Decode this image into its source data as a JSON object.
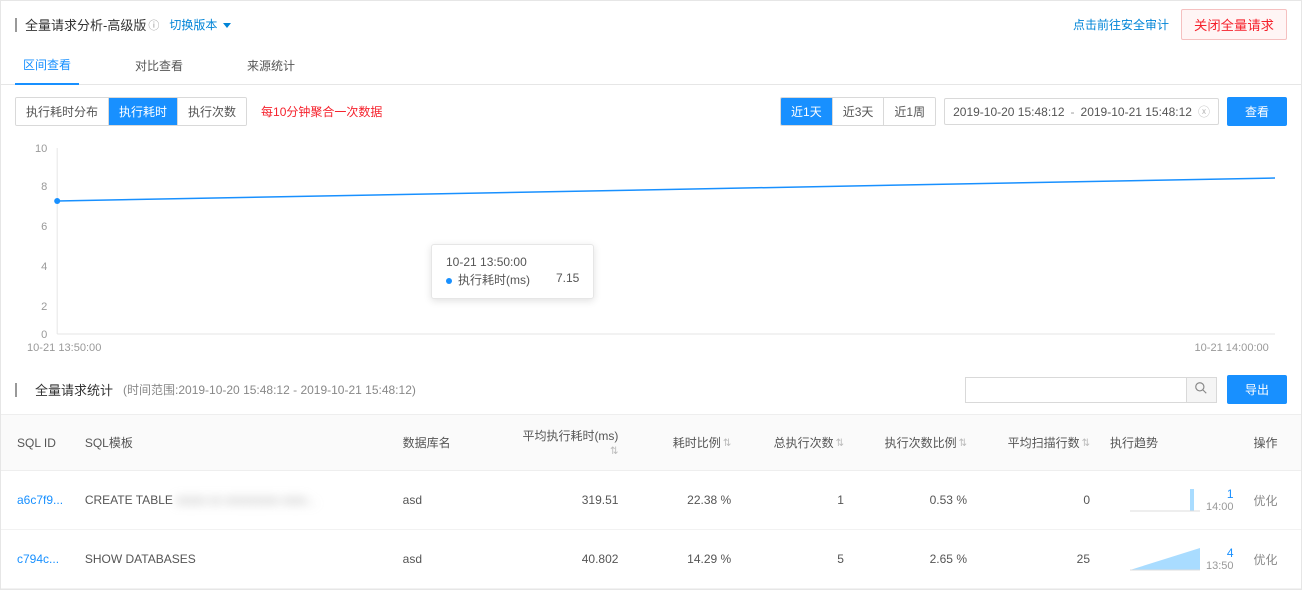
{
  "header": {
    "title": "全量请求分析-高级版",
    "help_icon": "help-icon",
    "switch_version": "切换版本",
    "audit_link": "点击前往安全审计",
    "close_btn": "关闭全量请求"
  },
  "tabs": [
    {
      "id": "interval",
      "label": "区间查看",
      "active": true
    },
    {
      "id": "compare",
      "label": "对比查看",
      "active": false
    },
    {
      "id": "source",
      "label": "来源统计",
      "active": false
    }
  ],
  "filter_group": [
    {
      "id": "dist",
      "label": "执行耗时分布",
      "active": false
    },
    {
      "id": "time",
      "label": "执行耗时",
      "active": true
    },
    {
      "id": "count",
      "label": "执行次数",
      "active": false
    }
  ],
  "agg_hint": "每10分钟聚合一次数据",
  "range_group": [
    {
      "id": "1d",
      "label": "近1天",
      "active": true
    },
    {
      "id": "3d",
      "label": "近3天",
      "active": false
    },
    {
      "id": "1w",
      "label": "近1周",
      "active": false
    }
  ],
  "time_range": {
    "from": "2019-10-20 15:48:12",
    "sep": "-",
    "to": "2019-10-21 15:48:12"
  },
  "view_btn": "查看",
  "chart_data": {
    "type": "line",
    "x": [
      "10-21 13:50:00",
      "10-21 14:00:00"
    ],
    "values": [
      7.15,
      8.4
    ],
    "ylim": [
      0,
      10
    ],
    "yticks": [
      0,
      2,
      4,
      6,
      8,
      10
    ],
    "xlabel": "",
    "ylabel": "",
    "series_name": "执行耗时(ms)",
    "tooltip": {
      "x": "10-21 13:50:00",
      "label": "执行耗时(ms)",
      "value": "7.15"
    },
    "accent": "#1890ff"
  },
  "section": {
    "title": "全量请求统计",
    "subtitle": "(时间范围:2019-10-20 15:48:12 - 2019-10-21 15:48:12)",
    "search_placeholder": "",
    "export_btn": "导出"
  },
  "table": {
    "columns": {
      "sql_id": "SQL ID",
      "template": "SQL模板",
      "db": "数据库名",
      "avg_time": "平均执行耗时(ms)",
      "time_pct": "耗时比例",
      "exec_count": "总执行次数",
      "exec_pct": "执行次数比例",
      "scan_rows": "平均扫描行数",
      "trend": "执行趋势",
      "ops": "操作"
    },
    "rows": [
      {
        "sql_id": "a6c7f9...",
        "template_prefix": "CREATE TABLE ",
        "template_blur": "xxxxx xx xxxxxxxxx xxxx...",
        "db": "asd",
        "avg_time": "319.51",
        "time_pct": "22.38 %",
        "exec_count": "1",
        "exec_pct": "0.53 %",
        "scan_rows": "0",
        "trend": {
          "shape": "spike",
          "value": "1",
          "time": "14:00"
        },
        "op": "优化"
      },
      {
        "sql_id": "c794c...",
        "template_prefix": "SHOW DATABASES",
        "template_blur": "",
        "db": "asd",
        "avg_time": "40.802",
        "time_pct": "14.29 %",
        "exec_count": "5",
        "exec_pct": "2.65 %",
        "scan_rows": "25",
        "trend": {
          "shape": "triangle",
          "value": "4",
          "time": "13:50"
        },
        "op": "优化"
      }
    ]
  }
}
